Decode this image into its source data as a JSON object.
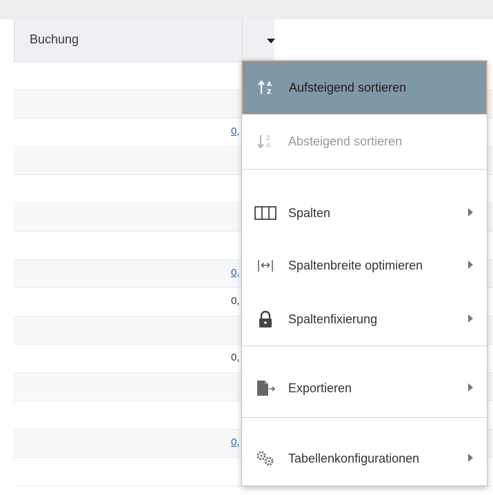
{
  "header": {
    "column_label": "Buchung"
  },
  "rows": [
    {
      "value": ""
    },
    {
      "value": ""
    },
    {
      "value": "0,",
      "link": true
    },
    {
      "value": ""
    },
    {
      "value": ""
    },
    {
      "value": ""
    },
    {
      "value": ""
    },
    {
      "value": "0,",
      "link": true
    },
    {
      "value": "0,",
      "link": false
    },
    {
      "value": ""
    },
    {
      "value": "0,",
      "link": false
    },
    {
      "value": ""
    },
    {
      "value": ""
    },
    {
      "value": "0,",
      "link": true
    },
    {
      "value": ""
    }
  ],
  "menu": {
    "sort_asc": "Aufsteigend sortieren",
    "sort_desc": "Absteigend sortieren",
    "columns": "Spalten",
    "col_width": "Spaltenbreite optimieren",
    "col_fix": "Spaltenfixierung",
    "export": "Exportieren",
    "table_config": "Tabellenkonfigurationen",
    "width_glyph": "|↔|"
  },
  "colors": {
    "selected_bg": "#7f98a6",
    "selected_border": "#e0a070",
    "link": "#2a5db0"
  }
}
